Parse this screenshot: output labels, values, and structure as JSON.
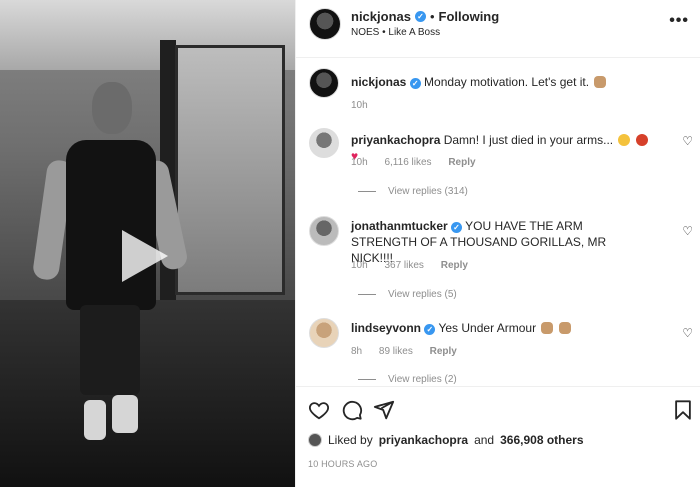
{
  "video": {
    "play_icon": "play-icon"
  },
  "header": {
    "username": "nickjonas",
    "separator": "•",
    "follow_label": "Following",
    "subtitle": "NOES • Like A Boss",
    "more_icon": "more-horizontal-icon",
    "more_label": "•••"
  },
  "caption": {
    "username": "nickjonas",
    "text": "Monday motivation. Let's get it.",
    "time": "10h"
  },
  "comments": [
    {
      "username": "priyankachopra",
      "verified": false,
      "text": "Damn! I just died in your arms...",
      "time": "10h",
      "likes": "6,116 likes",
      "reply_label": "Reply",
      "view_replies": "View replies (314)"
    },
    {
      "username": "jonathanmtucker",
      "verified": true,
      "text": "YOU HAVE THE ARM STRENGTH OF A THOUSAND GORILLAS, MR NICK!!!!",
      "time": "10h",
      "likes": "367 likes",
      "reply_label": "Reply",
      "view_replies": "View replies (5)"
    },
    {
      "username": "lindseyvonn",
      "verified": true,
      "text": "Yes Under Armour",
      "time": "8h",
      "likes": "89 likes",
      "reply_label": "Reply",
      "view_replies": "View replies (2)"
    }
  ],
  "actions": {
    "icons": [
      "heart-icon",
      "comment-icon",
      "share-icon",
      "bookmark-icon"
    ]
  },
  "likes_line": {
    "prefix": "Liked by",
    "first_liker": "priyankachopra",
    "and": "and",
    "others": "366,908 others"
  },
  "timestamp": "10 HOURS AGO",
  "colors": {
    "verified": "#3897f0",
    "muted": "#8e8e8e",
    "text": "#262626"
  }
}
